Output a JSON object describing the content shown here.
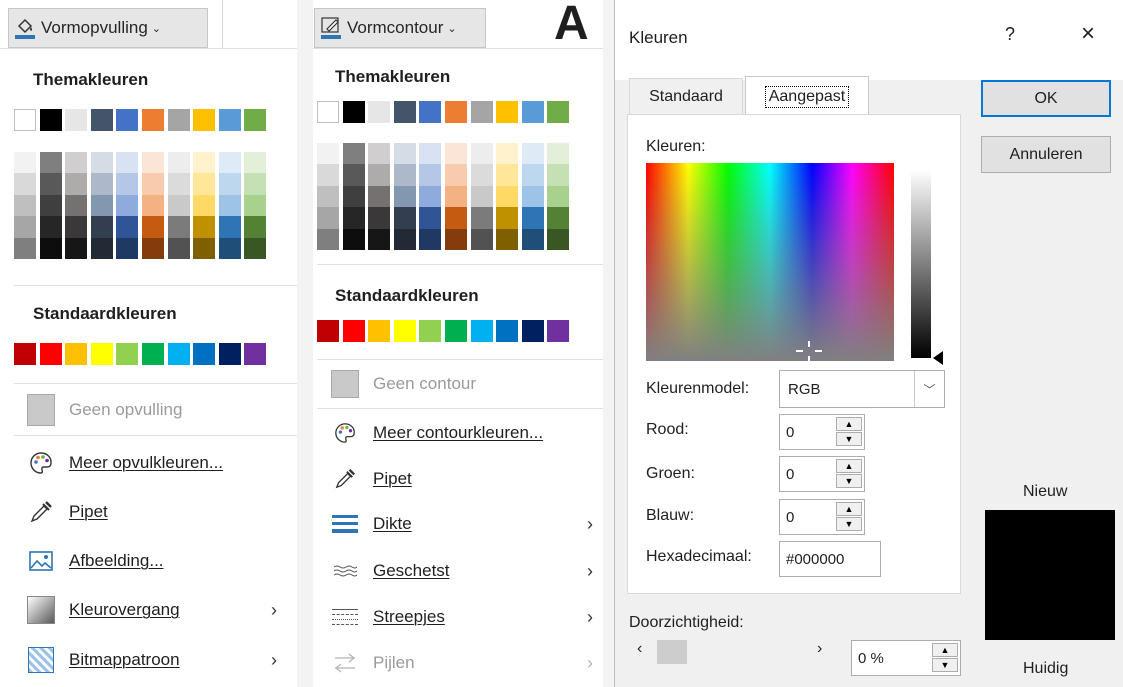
{
  "theme_colors": [
    "#ffffff",
    "#000000",
    "#e7e6e6",
    "#44546a",
    "#4472c4",
    "#ed7d31",
    "#a5a5a5",
    "#ffc000",
    "#5b9bd5",
    "#70ad47"
  ],
  "theme_shades": [
    [
      "#f2f2f2",
      "#d9d9d9",
      "#bfbfbf",
      "#a6a6a6",
      "#7f7f7f"
    ],
    [
      "#7f7f7f",
      "#595959",
      "#3f3f3f",
      "#262626",
      "#0d0d0d"
    ],
    [
      "#d0cece",
      "#aeabab",
      "#757171",
      "#3a3838",
      "#171616"
    ],
    [
      "#d6dce5",
      "#adb9ca",
      "#8497b0",
      "#333f50",
      "#222a35"
    ],
    [
      "#d9e2f3",
      "#b4c7e7",
      "#8faadc",
      "#2f5597",
      "#203864"
    ],
    [
      "#fbe5d6",
      "#f8cbad",
      "#f4b183",
      "#c55a11",
      "#843c0c"
    ],
    [
      "#ededed",
      "#dbdbdb",
      "#c9c9c9",
      "#7b7b7b",
      "#525252"
    ],
    [
      "#fff2cc",
      "#ffe699",
      "#ffd966",
      "#bf9000",
      "#7f6000"
    ],
    [
      "#deebf7",
      "#bdd7ee",
      "#9dc3e6",
      "#2e75b6",
      "#1f4e79"
    ],
    [
      "#e2f0d9",
      "#c5e0b4",
      "#a9d18e",
      "#548235",
      "#385723"
    ]
  ],
  "standard_colors": [
    "#c00000",
    "#ff0000",
    "#ffc000",
    "#ffff00",
    "#92d050",
    "#00b050",
    "#00b0f0",
    "#0070c0",
    "#002060",
    "#7030a0"
  ],
  "fill_menu": {
    "button_label": "Vormopvulling",
    "theme_title": "Themakleuren",
    "standard_title": "Standaardkleuren",
    "no_fill": "Geen opvulling",
    "more_colors": "Meer opvulkleuren...",
    "eyedropper": "Pipet",
    "picture": "Afbeelding...",
    "gradient": "Kleurovergang",
    "texture": "Bitmappatroon",
    "arrow": "›"
  },
  "outline_menu": {
    "button_label": "Vormcontour",
    "theme_title": "Themakleuren",
    "standard_title": "Standaardkleuren",
    "no_outline": "Geen contour",
    "more_colors": "Meer contourkleuren...",
    "eyedropper": "Pipet",
    "weight": "Dikte",
    "sketched": "Geschetst",
    "dashes": "Streepjes",
    "arrows": "Pijlen",
    "arrow": "›",
    "ribbon_letter": "A"
  },
  "dialog": {
    "title": "Kleuren",
    "help": "?",
    "close": "×",
    "tab_standard": "Standaard",
    "tab_custom": "Aangepast",
    "colors_label": "Kleuren:",
    "model_label": "Kleurenmodel:",
    "model_value": "RGB",
    "red_label": "Rood:",
    "green_label": "Groen:",
    "blue_label": "Blauw:",
    "hex_label": "Hexadecimaal:",
    "red_value": "0",
    "green_value": "0",
    "blue_value": "0",
    "hex_value": "#000000",
    "transparency_label": "Doorzichtigheid:",
    "transparency_value": "0 %",
    "ok": "OK",
    "cancel": "Annuleren",
    "new_label": "Nieuw",
    "current_label": "Huidig",
    "new_color": "#000000"
  }
}
